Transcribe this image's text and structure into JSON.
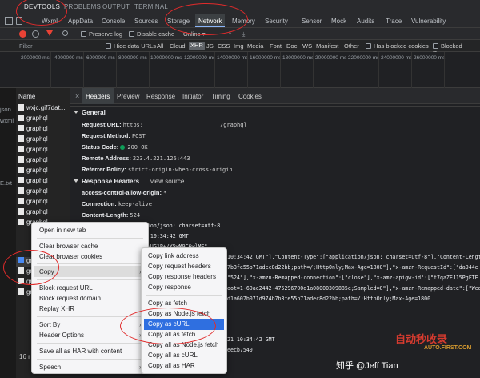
{
  "top_tabs": [
    "DEVTOOLS",
    "PROBLEMS",
    "OUTPUT",
    "TERMINAL"
  ],
  "panel_tabs": [
    "Wxml",
    "AppData",
    "Console",
    "Sources",
    "Storage",
    "Network",
    "Memory",
    "Security",
    "Sensor",
    "Mock",
    "Audits",
    "Trace",
    "Vulnerability"
  ],
  "active_panel_tab": "Network",
  "toolbar": {
    "preserve_log": "Preserve log",
    "disable_cache": "Disable cache",
    "throttle": "Online"
  },
  "filterbar": {
    "filter_label": "Filter",
    "hide_data_urls": "Hide data URLs",
    "types": [
      "All",
      "Cloud",
      "XHR",
      "JS",
      "CSS",
      "Img",
      "Media",
      "Font",
      "Doc",
      "WS",
      "Manifest",
      "Other"
    ],
    "active_type": "XHR",
    "has_blocked": "Has blocked cookies",
    "blocked_requests": "Blocked Reque"
  },
  "timeline_ticks": [
    "2000000 ms",
    "4000000 ms",
    "6000000 ms",
    "8000000 ms",
    "10000000 ms",
    "12000000 ms",
    "14000000 ms",
    "16000000 ms",
    "18000000 ms",
    "20000000 ms",
    "22000000 ms",
    "24000000 ms",
    "26000000 ms"
  ],
  "gutter_texts": [
    "json",
    "wxml",
    "E.txt"
  ],
  "requests": {
    "header": "Name",
    "rows": [
      "wxjc.gif7dat...",
      "graphql",
      "graphql",
      "graphql",
      "graphql",
      "graphql",
      "graphql",
      "graphql",
      "graphql",
      "graphql",
      "graphql",
      "graphql",
      "graphql",
      "graphql",
      "graphql",
      "graphql"
    ],
    "selected_index": 11
  },
  "detail_tabs": [
    "Headers",
    "Preview",
    "Response",
    "Initiator",
    "Timing",
    "Cookies"
  ],
  "active_detail_tab": "Headers",
  "general": {
    "title": "General",
    "request_url_key": "Request URL:",
    "request_url_val": "https:",
    "request_url_tail": "/graphql",
    "method_key": "Request Method:",
    "method_val": "POST",
    "status_key": "Status Code:",
    "status_val": "200 OK",
    "remote_key": "Remote Address:",
    "remote_val": "223.4.221.126:443",
    "referrer_key": "Referrer Policy:",
    "referrer_val": "strict-origin-when-cross-origin"
  },
  "response_headers": {
    "title": "Response Headers",
    "view_source": "view source",
    "rows": [
      {
        "k": "access-control-allow-origin:",
        "v": "*"
      },
      {
        "k": "Connection:",
        "v": "keep-alive"
      },
      {
        "k": "Content-Length:",
        "v": "524"
      }
    ]
  },
  "raw_lines": [
    "ation/json; charset=utf-8",
    "21 10:34:42 GMT",
    "DUvUG1P+/Y5wM9C6wlME\"",
    "10:34:42 GMT\"],\"Content-Type\":[\"application/json; charset=utf-8\"],\"Content-Lengt",
    "7b3fe55b71adec8d22bb;path=/;HttpOnly;Max-Age=1800\"],\"x-amzn-RequestId\":[\"da944e",
    "\"524\"],\"x-amzn-Remapped-connection\":[\"close\"],\"x-amz-apigw-id\":[\"f7qaZEJ15PgFTE",
    "oot=1-60ae2442-475296700d1a08000309885e;Sampled=0\"],\"x-amzn-Remapped-date\":[\"Wed",
    "d1a607b071d974b7b3fe55b71adec8d22bb;path=/;HttpOnly;Max-Age=1800",
    "21 10:34:42 GMT",
    "eecb7540"
  ],
  "context_menu": {
    "items": [
      "Open in new tab",
      "Clear browser cache",
      "Clear browser cookies",
      "Copy",
      "Block request URL",
      "Block request domain",
      "Replay XHR",
      "Sort By",
      "Header Options",
      "Save all as HAR with content",
      "Speech"
    ]
  },
  "copy_submenu": {
    "items": [
      "Copy link address",
      "Copy request headers",
      "Copy response headers",
      "Copy response",
      "Copy as fetch",
      "Copy as Node.js fetch",
      "Copy as cURL",
      "Copy all as fetch",
      "Copy all as Node.js fetch",
      "Copy all as cURL",
      "Copy all as HAR"
    ],
    "highlighted": "Copy as cURL"
  },
  "status_text": "16 r",
  "watermark": {
    "zhihu": "知乎 @Jeff Tian",
    "brand_cn": "自动秒收录",
    "brand_en": "AUTO.FIRST.COM"
  },
  "colors": {
    "accent": "#8ab4f8",
    "annotation_red": "#e02b2b",
    "menu_highlight": "#2f6fe0",
    "status_green": "#0f9d58"
  }
}
